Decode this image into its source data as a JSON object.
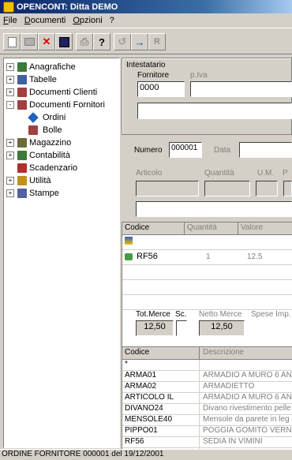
{
  "window": {
    "title": "OPENCONT: Ditta DEMO"
  },
  "menu": [
    "File",
    "Documenti",
    "Opzioni",
    "?"
  ],
  "toolbar": {
    "buttons": [
      "new",
      "open",
      "delete",
      "save",
      "print",
      "help",
      "refresh",
      "arrow-right",
      "report"
    ]
  },
  "tree": {
    "items": [
      {
        "label": "Anagrafiche",
        "expander": "+",
        "icon": "folder-icon",
        "color": "#3a7a3a"
      },
      {
        "label": "Tabelle",
        "expander": "+",
        "icon": "table-icon",
        "color": "#4060a0"
      },
      {
        "label": "Documenti Clienti",
        "expander": "+",
        "icon": "documents-icon",
        "color": "#a04040"
      },
      {
        "label": "Documenti Fornitori",
        "expander": "-",
        "icon": "documents-icon",
        "color": "#a04040"
      },
      {
        "label": "Ordini",
        "expander": "",
        "icon": "diamond-icon",
        "color": "#2060c0"
      },
      {
        "label": "Bolle",
        "expander": "",
        "icon": "bolle-icon",
        "color": "#a04040"
      },
      {
        "label": "Magazzino",
        "expander": "+",
        "icon": "warehouse-icon",
        "color": "#6a6a3a"
      },
      {
        "label": "Contabilità",
        "expander": "+",
        "icon": "accounting-icon",
        "color": "#3a7a3a"
      },
      {
        "label": "Scadenzario",
        "expander": "",
        "icon": "calendar-icon",
        "color": "#b03030"
      },
      {
        "label": "Utilità",
        "expander": "+",
        "icon": "utility-icon",
        "color": "#c09020"
      },
      {
        "label": "Stampe",
        "expander": "+",
        "icon": "printer-icon",
        "color": "#5060a0"
      }
    ]
  },
  "form": {
    "intestatario_label": "Intestatario",
    "fornitore_label": "Fornitore",
    "piva_label": "p.Iva",
    "fornitore_value": "0000",
    "piva_value": "",
    "name_value": "",
    "numero_label": "Numero",
    "numero_value": "000001",
    "data_label": "Data",
    "data_value": "",
    "articolo_label": "Articolo",
    "quantita_label": "Quantità",
    "um_label": "U.M.",
    "p_label": "P",
    "desc_value": ""
  },
  "order_grid": {
    "headers": [
      "Codice",
      "Quantità",
      "Valore"
    ],
    "rows": [
      {
        "codice": "RF56",
        "quantita": "1",
        "valore": "12.5"
      }
    ]
  },
  "totals": {
    "tot_merce_label": "Tot.Merce",
    "sc_label": "Sc.",
    "netto_label": "Netto Merce",
    "spese_label": "Spese Imp.",
    "tot_merce_value": "12,50",
    "sc_value": "",
    "netto_value": "12,50"
  },
  "article_grid": {
    "headers": [
      "Codice",
      "Descrizione"
    ],
    "rows": [
      {
        "codice": "*",
        "descrizione": ""
      },
      {
        "codice": "ARMA01",
        "descrizione": "ARMADIO A MURO 6 AN"
      },
      {
        "codice": "ARMA02",
        "descrizione": "ARMADIETTO"
      },
      {
        "codice": "ARTICOLO IL",
        "descrizione": "ARMADIO A MURO 6 AN"
      },
      {
        "codice": "DIVANO24",
        "descrizione": "Divano rivestimento pelle"
      },
      {
        "codice": "MENSOLE40",
        "descrizione": "Mensole da parete in leg"
      },
      {
        "codice": "PIPPO01",
        "descrizione": "POGGIA GOMITO VERNI"
      },
      {
        "codice": "RF56",
        "descrizione": "SEDIA IN VIMINI"
      }
    ]
  },
  "status": {
    "text": "ORDINE FORNITORE 000001 del 19/12/2001"
  }
}
